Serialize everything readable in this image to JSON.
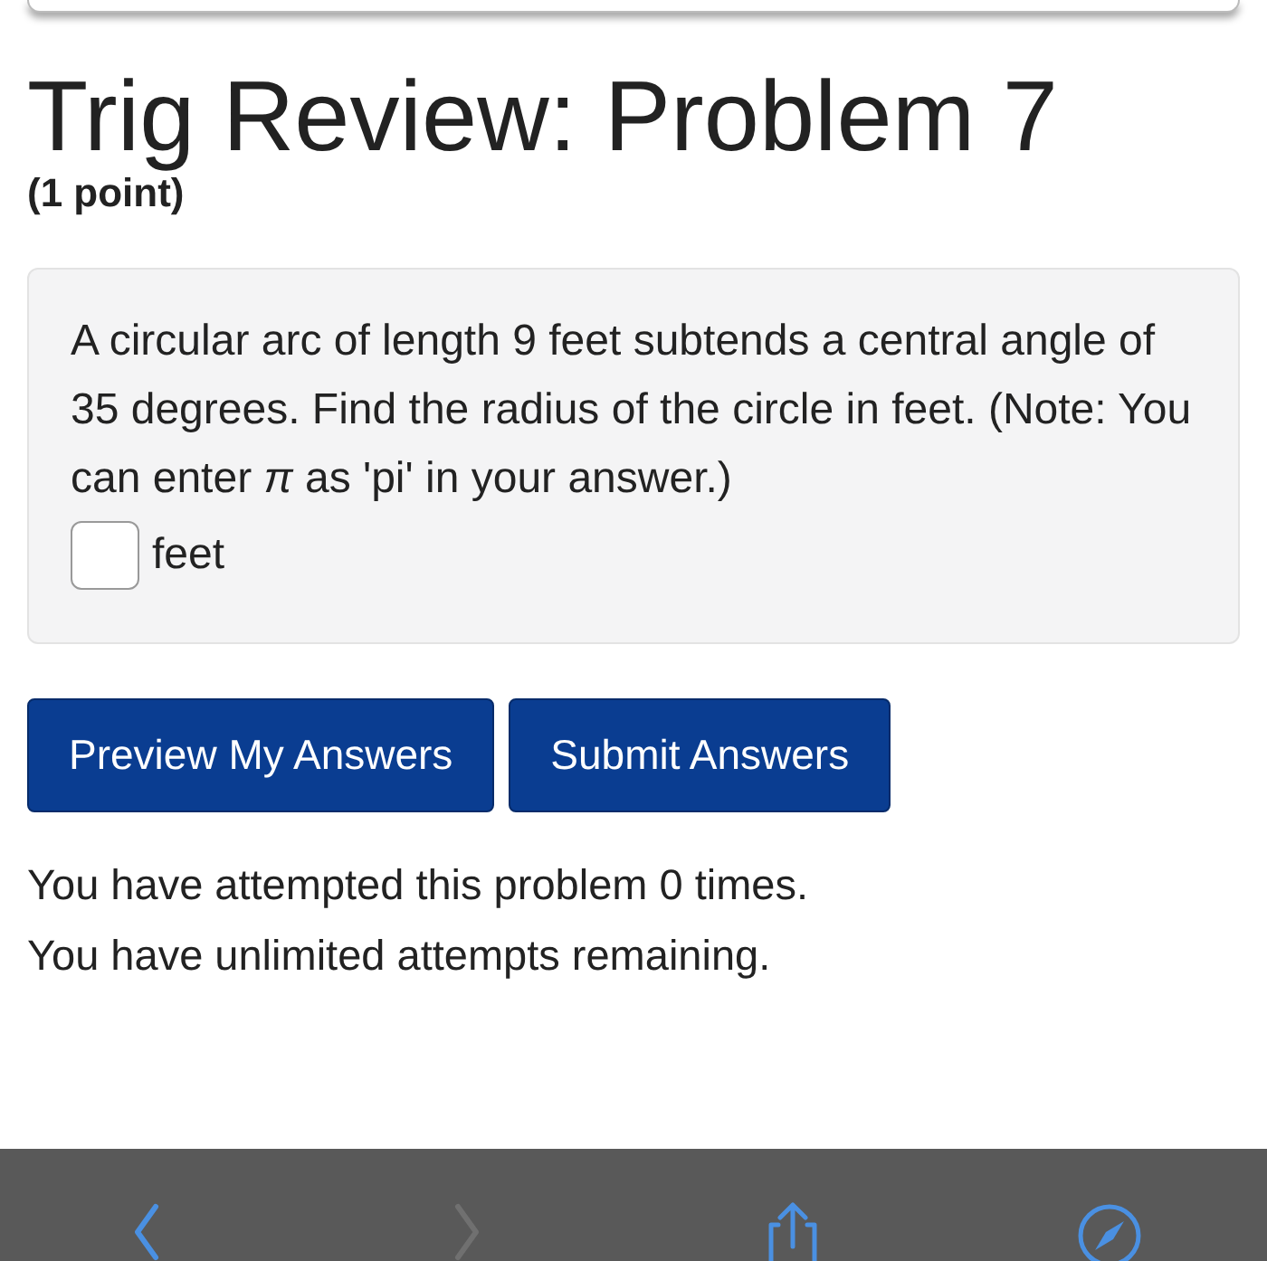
{
  "title": "Trig Review: Problem 7",
  "points": "(1 point)",
  "problem": {
    "text": "A circular arc of length 9 feet subtends a central angle of 35 degrees. Find the radius of the circle in feet. (Note: You can enter *π* as 'pi' in your answer.)",
    "answer": {
      "placeholder_unit": "feet"
    }
  },
  "buttons": [
    "Preview My Answers",
    "Submit Answers"
  ],
  "messages": [
    "You have attempted this problem 0 times.",
    "You have unlimited attempts remaining."
  ],
  "toolbar": [
    {
      "kind": "back",
      "disabled": false
    },
    {
      "kind": "forward",
      "disabled": true
    },
    {
      "kind": "share",
      "disabled": false
    },
    {
      "kind": "compass",
      "disabled": false
    }
  ]
}
